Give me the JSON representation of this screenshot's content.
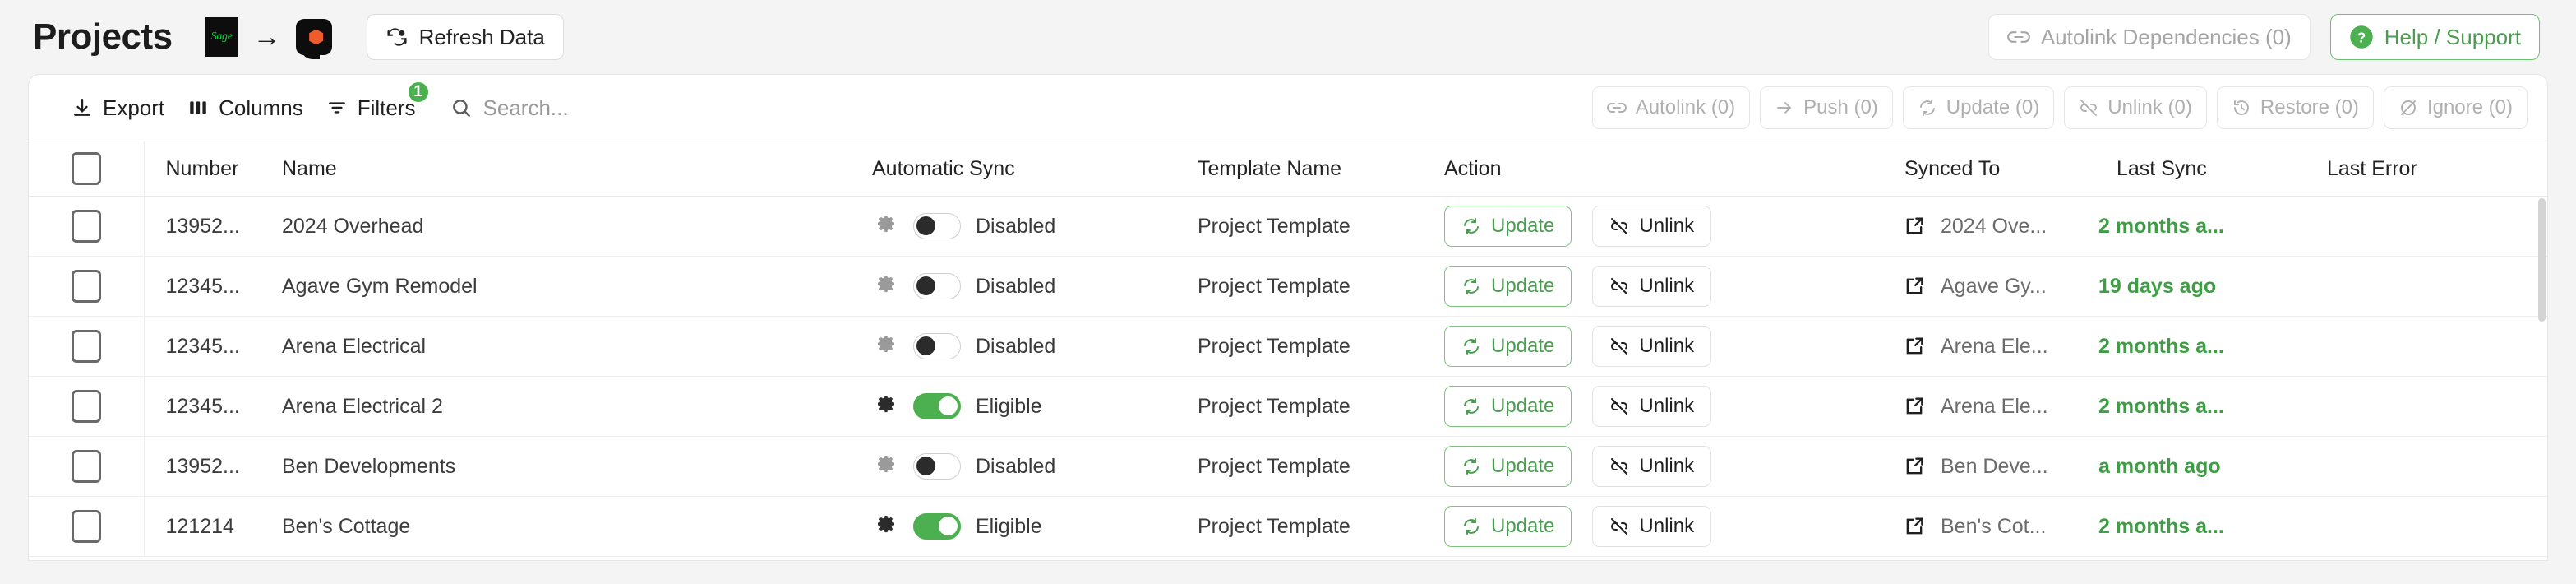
{
  "header": {
    "title": "Projects",
    "source_logo_text": "Sage",
    "arrow": "→",
    "refresh_button": "Refresh Data",
    "autolink_dependencies_button": "Autolink Dependencies (0)",
    "help_button": "Help / Support"
  },
  "toolbar": {
    "export_label": "Export",
    "columns_label": "Columns",
    "filters_label": "Filters",
    "filters_badge": "1",
    "search_placeholder": "Search...",
    "search_value": "",
    "actions": [
      {
        "label": "Autolink (0)",
        "icon": "link-icon",
        "disabled": true
      },
      {
        "label": "Push (0)",
        "icon": "arrow-right-icon",
        "disabled": true
      },
      {
        "label": "Update (0)",
        "icon": "refresh-icon",
        "disabled": true
      },
      {
        "label": "Unlink (0)",
        "icon": "broken-link-icon",
        "disabled": true
      },
      {
        "label": "Restore (0)",
        "icon": "history-icon",
        "disabled": true
      },
      {
        "label": "Ignore (0)",
        "icon": "eye-off-icon",
        "disabled": true
      }
    ]
  },
  "table": {
    "columns": [
      "Number",
      "Name",
      "Automatic Sync",
      "Template Name",
      "Action",
      "Synced To",
      "Last Sync",
      "Last Error"
    ],
    "rows": [
      {
        "number": "13952...",
        "name": "2024 Overhead",
        "sync_state": "Disabled",
        "sync_on": false,
        "template_name": "Project Template",
        "update_label": "Update",
        "unlink_label": "Unlink",
        "synced_to": "2024 Ove...",
        "last_sync": "2 months a...",
        "last_error": ""
      },
      {
        "number": "12345...",
        "name": "Agave Gym Remodel",
        "sync_state": "Disabled",
        "sync_on": false,
        "template_name": "Project Template",
        "update_label": "Update",
        "unlink_label": "Unlink",
        "synced_to": "Agave Gy...",
        "last_sync": "19 days ago",
        "last_error": ""
      },
      {
        "number": "12345...",
        "name": "Arena Electrical",
        "sync_state": "Disabled",
        "sync_on": false,
        "template_name": "Project Template",
        "update_label": "Update",
        "unlink_label": "Unlink",
        "synced_to": "Arena Ele...",
        "last_sync": "2 months a...",
        "last_error": ""
      },
      {
        "number": "12345...",
        "name": "Arena Electrical 2",
        "sync_state": "Eligible",
        "sync_on": true,
        "template_name": "Project Template",
        "update_label": "Update",
        "unlink_label": "Unlink",
        "synced_to": "Arena Ele...",
        "last_sync": "2 months a...",
        "last_error": ""
      },
      {
        "number": "13952...",
        "name": "Ben Developments",
        "sync_state": "Disabled",
        "sync_on": false,
        "template_name": "Project Template",
        "update_label": "Update",
        "unlink_label": "Unlink",
        "synced_to": "Ben Deve...",
        "last_sync": "a month ago",
        "last_error": ""
      },
      {
        "number": "121214",
        "name": "Ben's Cottage",
        "sync_state": "Eligible",
        "sync_on": true,
        "template_name": "Project Template",
        "update_label": "Update",
        "unlink_label": "Unlink",
        "synced_to": "Ben's Cot...",
        "last_sync": "2 months a...",
        "last_error": ""
      }
    ]
  },
  "colors": {
    "accent_green": "#4caf50",
    "link_green": "#3f9e45",
    "orange": "#ef5c2b",
    "sage_green": "#00d639",
    "page_bg": "#f4f4f4"
  }
}
